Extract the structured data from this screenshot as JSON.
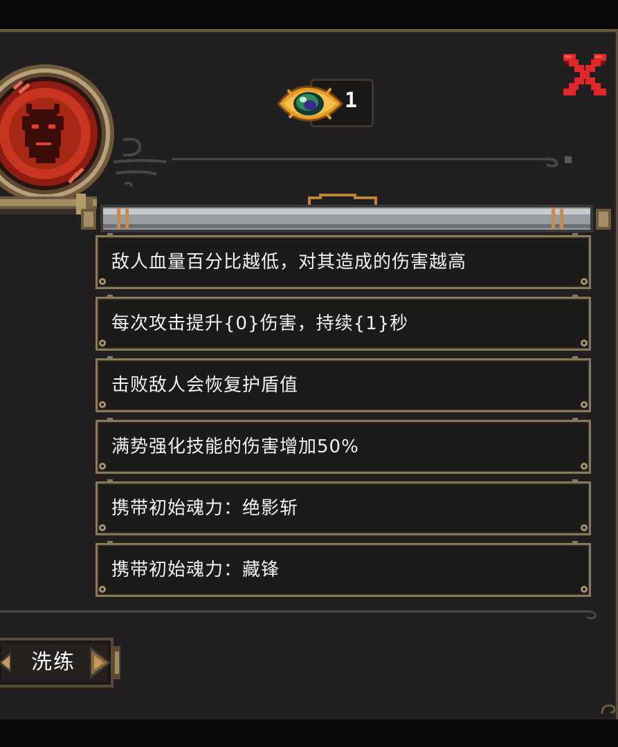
{
  "close_button": {
    "label": ""
  },
  "currency": {
    "icon": "eye-gem-icon",
    "count": "1"
  },
  "traits": [
    {
      "text": "敌人血量百分比越低，对其造成的伤害越高"
    },
    {
      "text": "每次攻击提升{0}伤害，持续{1}秒"
    },
    {
      "text": "击败敌人会恢复护盾值"
    },
    {
      "text": "满势强化技能的伤害增加50%"
    },
    {
      "text": "携带初始魂力：绝影斩"
    },
    {
      "text": "携带初始魂力：藏锋"
    }
  ],
  "refine_button": {
    "label": "洗练"
  },
  "colors": {
    "panel_bg": "#211f20",
    "border_gold": "#8a7a5a",
    "close_red": "#e0282a",
    "medallion_red": "#c7341f",
    "text_white": "#f2f2f2"
  }
}
